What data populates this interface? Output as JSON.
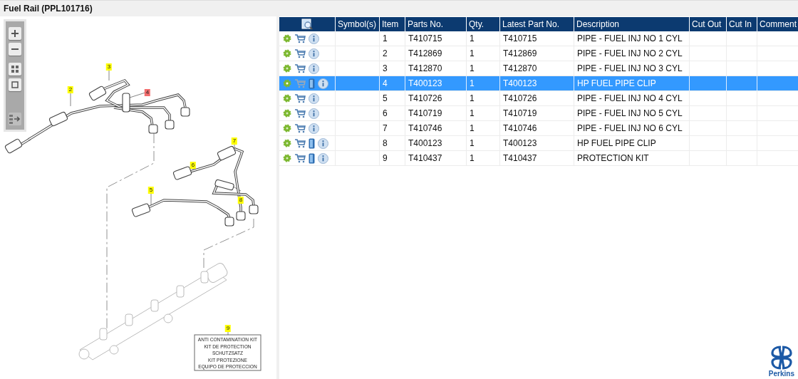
{
  "title": "Fuel Rail (PPL101716)",
  "diagram": {
    "callouts": [
      {
        "label": "2",
        "selected": false
      },
      {
        "label": "3",
        "selected": false
      },
      {
        "label": "4",
        "selected": true
      },
      {
        "label": "5",
        "selected": false
      },
      {
        "label": "6",
        "selected": false
      },
      {
        "label": "7",
        "selected": false
      },
      {
        "label": "8",
        "selected": false
      },
      {
        "label": "9",
        "selected": false
      }
    ],
    "kit_label": [
      "ANTI CONTAMINATION KIT",
      "KIT DE PROTECTION",
      "SCHUTZSATZ",
      "KIT PROTEZIONE",
      "EQUIPO DE PROTECCION"
    ]
  },
  "table": {
    "columns": [
      "Symbol(s)",
      "Item",
      "Parts No.",
      "Qty.",
      "Latest Part No.",
      "Description",
      "Cut Out",
      "Cut In",
      "Comment"
    ],
    "rows": [
      {
        "item": "1",
        "parts_no": "T410715",
        "qty": "1",
        "latest": "T410715",
        "description": "PIPE - FUEL INJ NO 1 CYL",
        "bulletin": false,
        "selected": false
      },
      {
        "item": "2",
        "parts_no": "T412869",
        "qty": "1",
        "latest": "T412869",
        "description": "PIPE - FUEL INJ NO 2 CYL",
        "bulletin": false,
        "selected": false
      },
      {
        "item": "3",
        "parts_no": "T412870",
        "qty": "1",
        "latest": "T412870",
        "description": "PIPE - FUEL INJ NO 3 CYL",
        "bulletin": false,
        "selected": false
      },
      {
        "item": "4",
        "parts_no": "T400123",
        "qty": "1",
        "latest": "T400123",
        "description": "HP FUEL PIPE CLIP",
        "bulletin": true,
        "selected": true
      },
      {
        "item": "5",
        "parts_no": "T410726",
        "qty": "1",
        "latest": "T410726",
        "description": "PIPE - FUEL INJ NO 4 CYL",
        "bulletin": false,
        "selected": false
      },
      {
        "item": "6",
        "parts_no": "T410719",
        "qty": "1",
        "latest": "T410719",
        "description": "PIPE - FUEL INJ NO 5 CYL",
        "bulletin": false,
        "selected": false
      },
      {
        "item": "7",
        "parts_no": "T410746",
        "qty": "1",
        "latest": "T410746",
        "description": "PIPE - FUEL INJ NO 6 CYL",
        "bulletin": false,
        "selected": false
      },
      {
        "item": "8",
        "parts_no": "T400123",
        "qty": "1",
        "latest": "T400123",
        "description": "HP FUEL PIPE CLIP",
        "bulletin": true,
        "selected": false
      },
      {
        "item": "9",
        "parts_no": "T410437",
        "qty": "1",
        "latest": "T410437",
        "description": "PROTECTION KIT",
        "bulletin": true,
        "selected": false
      }
    ]
  },
  "logo": {
    "text": "Perkins"
  }
}
